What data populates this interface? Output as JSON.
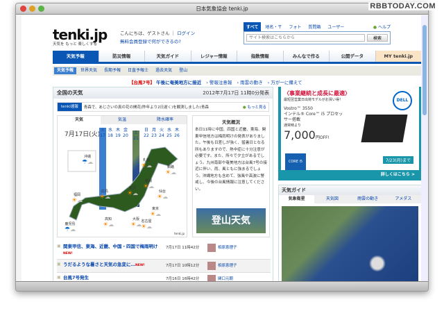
{
  "watermark": "RBBTODAY.COM",
  "window": {
    "title": "日本気象協会 tenki.jp"
  },
  "header": {
    "logo": "tenki.jp",
    "tagline": "天気を もっと 楽しくする",
    "greeting": "こんにちは、ゲストさん",
    "login": "ログイン",
    "register": "無料会員登録で何ができるの?"
  },
  "search": {
    "tabs": [
      "すべて",
      "地名・〒",
      "フォト",
      "質問箱",
      "ユーザー"
    ],
    "help": "ヘルプ",
    "placeholder": "サイト検索はこちらから",
    "button": "検索"
  },
  "nav": [
    "天気予報",
    "防災情報",
    "天気ガイド",
    "レジャー情報",
    "指数情報",
    "みんなで作る",
    "公開データ",
    "MY tenki.jp"
  ],
  "subnav": [
    "天気予報",
    "世界天気",
    "長期予報",
    "日直予報士",
    "過去天気",
    "登山"
  ],
  "alert": {
    "tag": "【台風7号】",
    "headline": "午後に奄美地方に接近",
    "links": [
      "警報注意報",
      "雨雲の動き",
      "万が一に備えて"
    ]
  },
  "main": {
    "title": "全国の天気",
    "published": "2012年7月17日 11時0分発表",
    "ticker": {
      "label": "tenki速報",
      "text": "青森で、あじさいの真の花の開花(昨年より2日遅く)を観測しました(青森",
      "more": "もっと見る"
    },
    "tabs": [
      "天気",
      "気温",
      "降水確率"
    ],
    "date": "7月17日(火)",
    "days": [
      {
        "w": "火",
        "d": "17"
      },
      {
        "w": "水",
        "d": "18"
      },
      {
        "w": "木",
        "d": "19"
      },
      {
        "w": "金",
        "d": "20"
      },
      {
        "w": "土",
        "d": "21"
      },
      {
        "w": "日",
        "d": "22"
      },
      {
        "w": "月",
        "d": "23"
      },
      {
        "w": "火",
        "d": "24"
      },
      {
        "w": "水",
        "d": "25"
      },
      {
        "w": "木",
        "d": "26"
      }
    ],
    "cities": [
      "札幌",
      "釧路",
      "沖縄",
      "新潟",
      "金沢",
      "仙台",
      "福岡",
      "広島",
      "東京",
      "高知",
      "大阪",
      "名古屋",
      "鹿児島"
    ],
    "map_credit": "tenki.jp",
    "overview": {
      "title": "天気概況",
      "text": "本日11時に中国、四国と近畿、東海、関東甲信地方は梅雨明けの発表がありました。午後も日差しが強く、猛暑日となる所もありますので、熱中症に十分注意が必要です。また、所々で夕立があるでしょう。九州南部や奄美地方は台風7号の接近に伴い、雨、風ともに強まるでしょう。沖縄地方も含めて、強風や高波に警戒し、今後の台風情報に注意してください。",
      "banner": "登山天気"
    },
    "news": [
      {
        "title": "関東甲信、東海、近畿、中国・四国で梅雨明け",
        "new": "NEW!",
        "time": "7月17日 11時42分",
        "author": "相原恵理子"
      },
      {
        "title": "うだるような暑さと天気の急変に…",
        "new": "NEW!",
        "time": "7月17日 10時12分",
        "author": "相原恵理子"
      },
      {
        "title": "台風7号発生",
        "new": "",
        "time": "7月16日 16時42分",
        "author": "関口元朝"
      }
    ]
  },
  "ad": {
    "headline": "〈事業継続と成長に最適〉",
    "sub": "最短翌営業日出荷モデルがお買い得！",
    "brand": "DELL",
    "model": "Vostro™ 3550",
    "cpu": "インテル® Core™ i5 プロセッサー搭載",
    "note": "通常時より",
    "price": "7,000",
    "price_unit": "円OFF!",
    "intel": "CORE i5",
    "until": "7/23(月)まで",
    "detail": "詳しくはこちら >"
  },
  "guide": {
    "title": "天気ガイド",
    "tabs": [
      "気象衛星",
      "天気図",
      "雨雲の動き",
      "アメダス"
    ]
  }
}
